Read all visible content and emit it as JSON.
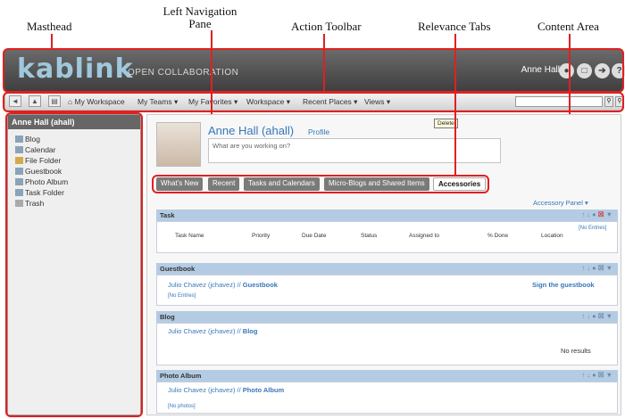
{
  "callouts": {
    "masthead": "Masthead",
    "left_nav": "Left Navigation Pane",
    "action_toolbar": "Action Toolbar",
    "relevance_tabs": "Relevance Tabs",
    "content_area": "Content Area"
  },
  "masthead": {
    "logo": "kablink",
    "logo_sub": "OPEN COLLABORATION",
    "user": "Anne Hall"
  },
  "toolbar": {
    "items": [
      "My Workspace",
      "My Teams",
      "My Favorites",
      "Workspace",
      "Recent Places",
      "Views"
    ]
  },
  "leftnav": {
    "title": "Anne Hall (ahall)",
    "items": [
      "Blog",
      "Calendar",
      "File Folder",
      "Guestbook",
      "Photo Album",
      "Task Folder",
      "Trash"
    ]
  },
  "profile": {
    "name": "Anne Hall (ahall)",
    "profile_link": "Profile",
    "status_placeholder": "What are you working on?"
  },
  "tabs": [
    "What's New",
    "Recent",
    "Tasks and Calendars",
    "Micro-Blogs and Shared Items",
    "Accessories"
  ],
  "accessory_panel": "Accessory Panel",
  "task": {
    "title": "Task",
    "no_entries": "[No Entries]",
    "tooltip": "Delete",
    "columns": [
      "Task Name",
      "Priority",
      "Due Date",
      "Status",
      "Assigned to",
      "% Done",
      "Location"
    ]
  },
  "guestbook": {
    "title": "Guestbook",
    "owner": "Julio Chavez (jchavez) //",
    "name": "Guestbook",
    "sign": "Sign the guestbook",
    "no_entries": "[No Entries]"
  },
  "blog": {
    "title": "Blog",
    "owner": "Julio Chavez (jchavez) //",
    "name": "Blog",
    "no_results": "No results"
  },
  "photo": {
    "title": "Photo Album",
    "owner": "Julio Chavez (jchavez) //",
    "name": "Photo Album",
    "no_photos": "[No photos]"
  }
}
